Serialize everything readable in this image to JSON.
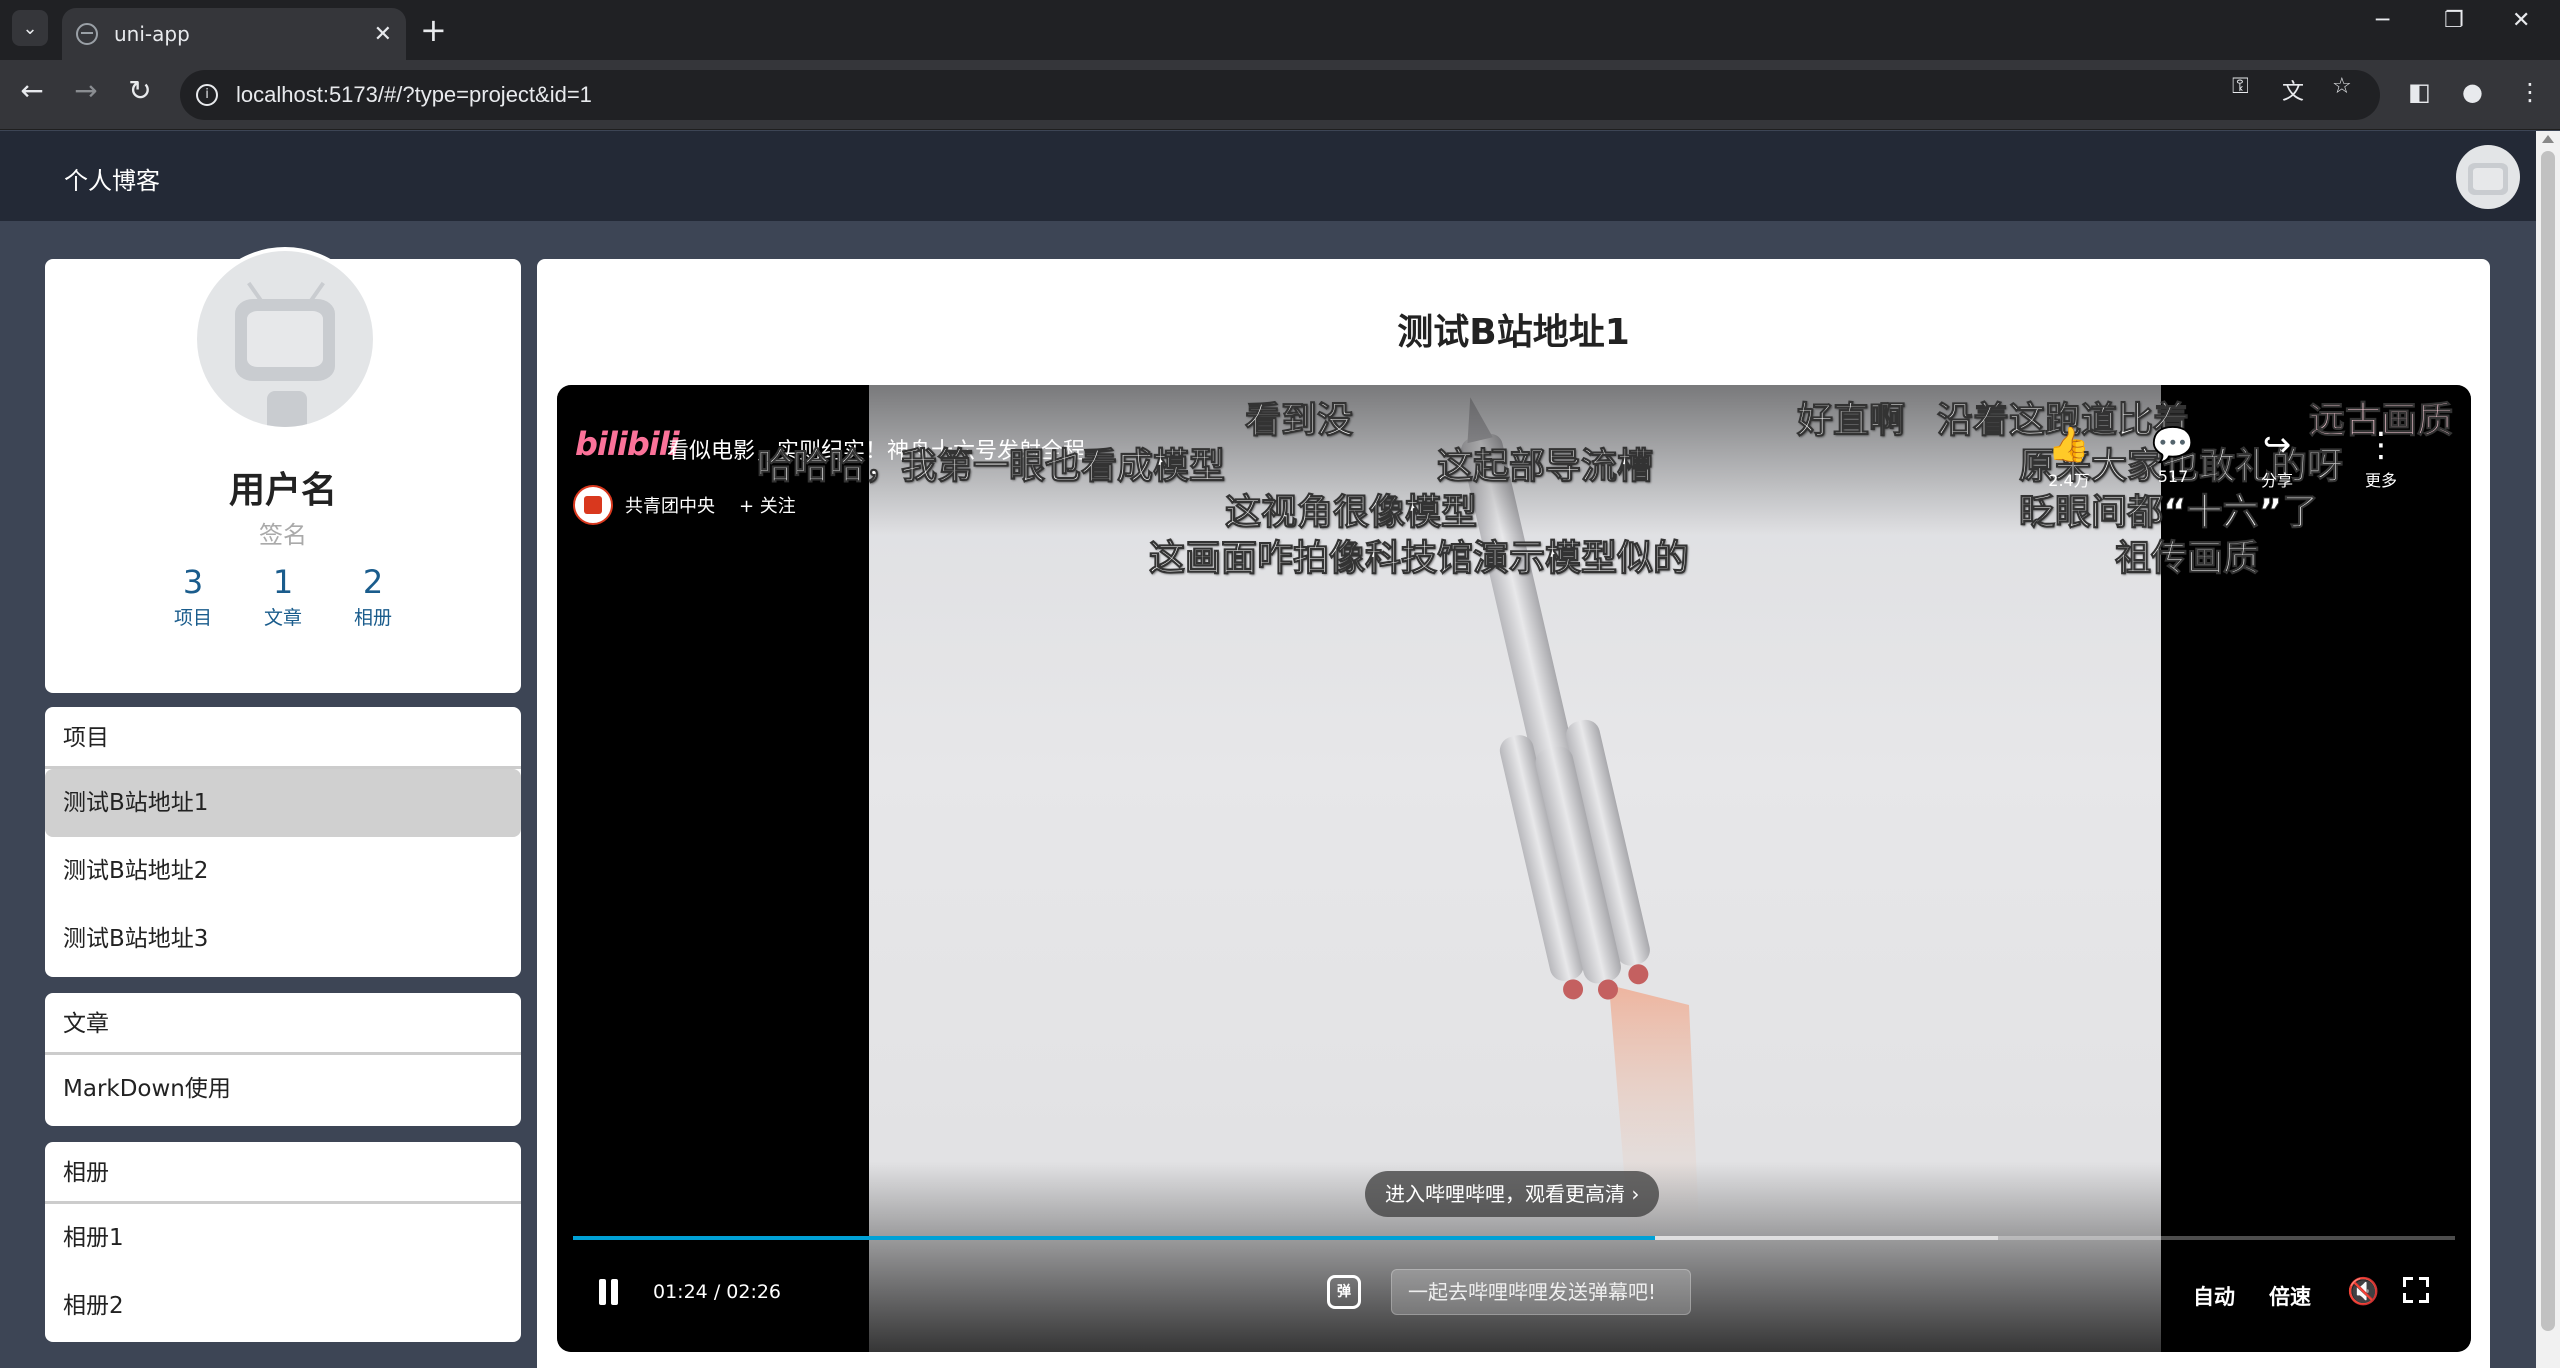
{
  "browser": {
    "tab_title": "uni-app",
    "url": "localhost:5173/#/?type=project&id=1"
  },
  "header": {
    "brand": "个人博客"
  },
  "profile": {
    "username": "用户名",
    "signature": "签名",
    "stats": [
      {
        "count": "3",
        "label": "项目"
      },
      {
        "count": "1",
        "label": "文章"
      },
      {
        "count": "2",
        "label": "相册"
      }
    ]
  },
  "menus": {
    "projects": {
      "heading": "项目",
      "items": [
        "测试B站地址1",
        "测试B站地址2",
        "测试B站地址3"
      ],
      "active_index": 0
    },
    "articles": {
      "heading": "文章",
      "items": [
        "MarkDown使用"
      ]
    },
    "albums": {
      "heading": "相册",
      "items": [
        "相册1",
        "相册2"
      ]
    }
  },
  "main": {
    "title": "测试B站地址1"
  },
  "player": {
    "logo": "bilibili",
    "video_title": "看似电影，实则纪实！神舟十六号发射全程",
    "uploader": "共青团中央",
    "follow": "+ 关注",
    "actions": [
      {
        "icon": "thumb-up-icon",
        "glyph": "👍",
        "count": "2.4万"
      },
      {
        "icon": "comment-icon",
        "glyph": "💬",
        "count": "517"
      },
      {
        "icon": "share-icon",
        "glyph": "↪",
        "count": "分享"
      },
      {
        "icon": "more-icon",
        "glyph": "⋮",
        "count": "更多"
      }
    ],
    "danmaku": [
      "看到没",
      "好直啊",
      "沿着这跑道比着",
      "远古画质",
      "哈哈哈，我第一眼也看成模型",
      "这起部导流槽",
      "原来大家也敢礼的呀",
      "这视角很像模型",
      "眨眼间都“十六”了",
      "这画面咋拍像科技馆演示模型似的",
      "祖传画质"
    ],
    "hd_prompt": "进入哔哩哔哩，观看更高清 ›",
    "time_current": "01:24",
    "time_separator": "/",
    "time_total": "02:26",
    "progress_played": 0.575,
    "progress_buffered": 0.757,
    "danmaku_toggle": "弹",
    "danmaku_input_placeholder": "一起去哔哩哔哩发送弹幕吧!",
    "auto_label": "自动",
    "speed_label": "倍速",
    "accent_color": "#00a1d6"
  }
}
